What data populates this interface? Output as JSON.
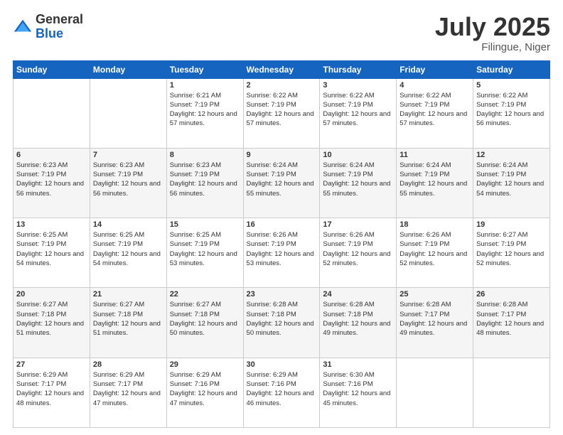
{
  "logo": {
    "general": "General",
    "blue": "Blue"
  },
  "header": {
    "month": "July 2025",
    "location": "Filingue, Niger"
  },
  "weekdays": [
    "Sunday",
    "Monday",
    "Tuesday",
    "Wednesday",
    "Thursday",
    "Friday",
    "Saturday"
  ],
  "weeks": [
    [
      {
        "day": "",
        "sunrise": "",
        "sunset": "",
        "daylight": ""
      },
      {
        "day": "",
        "sunrise": "",
        "sunset": "",
        "daylight": ""
      },
      {
        "day": "1",
        "sunrise": "Sunrise: 6:21 AM",
        "sunset": "Sunset: 7:19 PM",
        "daylight": "Daylight: 12 hours and 57 minutes."
      },
      {
        "day": "2",
        "sunrise": "Sunrise: 6:22 AM",
        "sunset": "Sunset: 7:19 PM",
        "daylight": "Daylight: 12 hours and 57 minutes."
      },
      {
        "day": "3",
        "sunrise": "Sunrise: 6:22 AM",
        "sunset": "Sunset: 7:19 PM",
        "daylight": "Daylight: 12 hours and 57 minutes."
      },
      {
        "day": "4",
        "sunrise": "Sunrise: 6:22 AM",
        "sunset": "Sunset: 7:19 PM",
        "daylight": "Daylight: 12 hours and 57 minutes."
      },
      {
        "day": "5",
        "sunrise": "Sunrise: 6:22 AM",
        "sunset": "Sunset: 7:19 PM",
        "daylight": "Daylight: 12 hours and 56 minutes."
      }
    ],
    [
      {
        "day": "6",
        "sunrise": "Sunrise: 6:23 AM",
        "sunset": "Sunset: 7:19 PM",
        "daylight": "Daylight: 12 hours and 56 minutes."
      },
      {
        "day": "7",
        "sunrise": "Sunrise: 6:23 AM",
        "sunset": "Sunset: 7:19 PM",
        "daylight": "Daylight: 12 hours and 56 minutes."
      },
      {
        "day": "8",
        "sunrise": "Sunrise: 6:23 AM",
        "sunset": "Sunset: 7:19 PM",
        "daylight": "Daylight: 12 hours and 56 minutes."
      },
      {
        "day": "9",
        "sunrise": "Sunrise: 6:24 AM",
        "sunset": "Sunset: 7:19 PM",
        "daylight": "Daylight: 12 hours and 55 minutes."
      },
      {
        "day": "10",
        "sunrise": "Sunrise: 6:24 AM",
        "sunset": "Sunset: 7:19 PM",
        "daylight": "Daylight: 12 hours and 55 minutes."
      },
      {
        "day": "11",
        "sunrise": "Sunrise: 6:24 AM",
        "sunset": "Sunset: 7:19 PM",
        "daylight": "Daylight: 12 hours and 55 minutes."
      },
      {
        "day": "12",
        "sunrise": "Sunrise: 6:24 AM",
        "sunset": "Sunset: 7:19 PM",
        "daylight": "Daylight: 12 hours and 54 minutes."
      }
    ],
    [
      {
        "day": "13",
        "sunrise": "Sunrise: 6:25 AM",
        "sunset": "Sunset: 7:19 PM",
        "daylight": "Daylight: 12 hours and 54 minutes."
      },
      {
        "day": "14",
        "sunrise": "Sunrise: 6:25 AM",
        "sunset": "Sunset: 7:19 PM",
        "daylight": "Daylight: 12 hours and 54 minutes."
      },
      {
        "day": "15",
        "sunrise": "Sunrise: 6:25 AM",
        "sunset": "Sunset: 7:19 PM",
        "daylight": "Daylight: 12 hours and 53 minutes."
      },
      {
        "day": "16",
        "sunrise": "Sunrise: 6:26 AM",
        "sunset": "Sunset: 7:19 PM",
        "daylight": "Daylight: 12 hours and 53 minutes."
      },
      {
        "day": "17",
        "sunrise": "Sunrise: 6:26 AM",
        "sunset": "Sunset: 7:19 PM",
        "daylight": "Daylight: 12 hours and 52 minutes."
      },
      {
        "day": "18",
        "sunrise": "Sunrise: 6:26 AM",
        "sunset": "Sunset: 7:19 PM",
        "daylight": "Daylight: 12 hours and 52 minutes."
      },
      {
        "day": "19",
        "sunrise": "Sunrise: 6:27 AM",
        "sunset": "Sunset: 7:19 PM",
        "daylight": "Daylight: 12 hours and 52 minutes."
      }
    ],
    [
      {
        "day": "20",
        "sunrise": "Sunrise: 6:27 AM",
        "sunset": "Sunset: 7:18 PM",
        "daylight": "Daylight: 12 hours and 51 minutes."
      },
      {
        "day": "21",
        "sunrise": "Sunrise: 6:27 AM",
        "sunset": "Sunset: 7:18 PM",
        "daylight": "Daylight: 12 hours and 51 minutes."
      },
      {
        "day": "22",
        "sunrise": "Sunrise: 6:27 AM",
        "sunset": "Sunset: 7:18 PM",
        "daylight": "Daylight: 12 hours and 50 minutes."
      },
      {
        "day": "23",
        "sunrise": "Sunrise: 6:28 AM",
        "sunset": "Sunset: 7:18 PM",
        "daylight": "Daylight: 12 hours and 50 minutes."
      },
      {
        "day": "24",
        "sunrise": "Sunrise: 6:28 AM",
        "sunset": "Sunset: 7:18 PM",
        "daylight": "Daylight: 12 hours and 49 minutes."
      },
      {
        "day": "25",
        "sunrise": "Sunrise: 6:28 AM",
        "sunset": "Sunset: 7:17 PM",
        "daylight": "Daylight: 12 hours and 49 minutes."
      },
      {
        "day": "26",
        "sunrise": "Sunrise: 6:28 AM",
        "sunset": "Sunset: 7:17 PM",
        "daylight": "Daylight: 12 hours and 48 minutes."
      }
    ],
    [
      {
        "day": "27",
        "sunrise": "Sunrise: 6:29 AM",
        "sunset": "Sunset: 7:17 PM",
        "daylight": "Daylight: 12 hours and 48 minutes."
      },
      {
        "day": "28",
        "sunrise": "Sunrise: 6:29 AM",
        "sunset": "Sunset: 7:17 PM",
        "daylight": "Daylight: 12 hours and 47 minutes."
      },
      {
        "day": "29",
        "sunrise": "Sunrise: 6:29 AM",
        "sunset": "Sunset: 7:16 PM",
        "daylight": "Daylight: 12 hours and 47 minutes."
      },
      {
        "day": "30",
        "sunrise": "Sunrise: 6:29 AM",
        "sunset": "Sunset: 7:16 PM",
        "daylight": "Daylight: 12 hours and 46 minutes."
      },
      {
        "day": "31",
        "sunrise": "Sunrise: 6:30 AM",
        "sunset": "Sunset: 7:16 PM",
        "daylight": "Daylight: 12 hours and 45 minutes."
      },
      {
        "day": "",
        "sunrise": "",
        "sunset": "",
        "daylight": ""
      },
      {
        "day": "",
        "sunrise": "",
        "sunset": "",
        "daylight": ""
      }
    ]
  ]
}
